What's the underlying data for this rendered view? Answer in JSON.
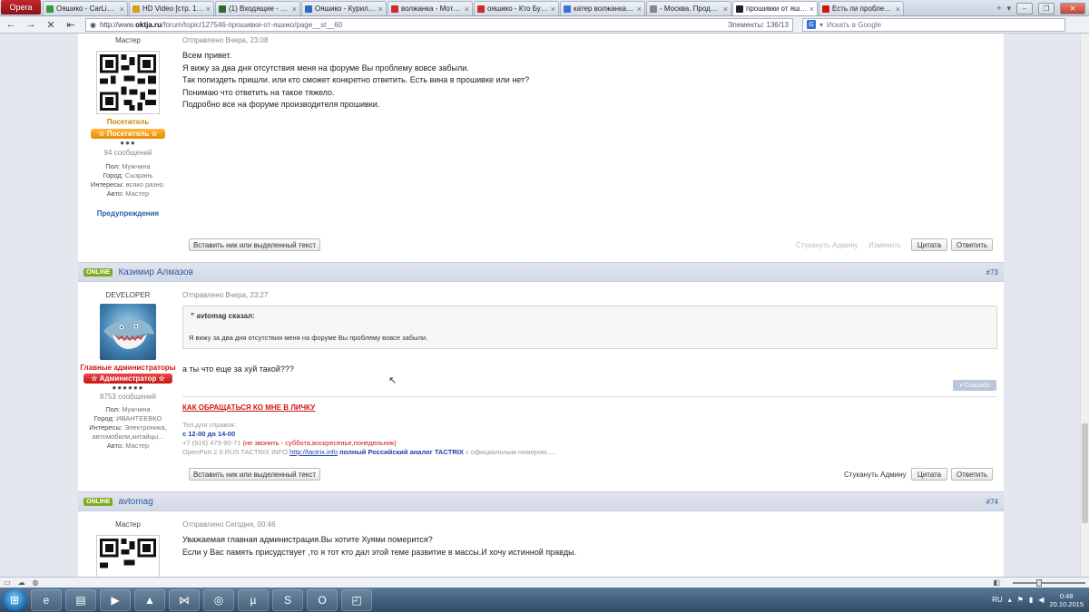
{
  "browser": {
    "opera_label": "Opera",
    "tabs": [
      {
        "title": "Ояшико - CarLine For...",
        "color": "#3a9a3a",
        "active": false
      },
      {
        "title": "HD Video [стр. 1] :: Ки...",
        "color": "#d8a019",
        "active": false
      },
      {
        "title": "(1) Входящие - avtom...",
        "color": "#2d6a2d",
        "active": false
      },
      {
        "title": "Ояшико - Курилка - ...",
        "color": "#2a6ac8",
        "active": false
      },
      {
        "title": "волжанка - Моторны...",
        "color": "#d02a2a",
        "active": false
      },
      {
        "title": "ояшико - Кто Бухает ...",
        "color": "#d02a2a",
        "active": false
      },
      {
        "title": "катер волжанка фор...",
        "color": "#3b74d4",
        "active": false
      },
      {
        "title": "- Москва. Продается ...",
        "color": "#888888",
        "active": false
      },
      {
        "title": "прошивки от яшик...",
        "color": "#222222",
        "active": true
      },
      {
        "title": "Есть ли проблемы с ...",
        "color": "#d01515",
        "active": false
      }
    ],
    "url_prefix": "http://www.",
    "url_host": "oktja.ru",
    "url_rest": "/forum/topic/127546-прошивки-от-яшико/page__st__60",
    "elements_label": "Элементы:",
    "elements_count": "136/13",
    "search_placeholder": "Искать в Google",
    "search_engine": "G"
  },
  "posts": [
    {
      "role": "Мастер",
      "posted": "Отправлено Вчера, 23:08",
      "rank_text": "Посетитель",
      "badge": "Посетитель",
      "dots": "●●●",
      "msg_count": "94 сообщений",
      "info": [
        {
          "k": "Пол:",
          "v": "Мужчина"
        },
        {
          "k": "Город:",
          "v": "Сызрань"
        },
        {
          "k": "Интересы:",
          "v": "всяко разно."
        },
        {
          "k": "Авто:",
          "v": "Мастер"
        }
      ],
      "warnings": "Предупреждения",
      "lines": [
        "Всем привет.",
        "Я вижу за два дня отсутствия меня на форуме Вы проблему вовсе забыли.",
        "Так попиздеть пришли. или кто сможет конкретно ответить. Есть вина в прошивке или нет?",
        "Понимаю что ответить на такое тяжело.",
        "Подробно все на форуме производителя прошивки."
      ],
      "insert_btn": "Вставить ник или выделенный текст",
      "report": "Стукануть Админу",
      "edit": "Изменить",
      "quote_btn": "Цитата",
      "reply_btn": "Ответить"
    },
    {
      "online": "ONLINE",
      "name": "Казимир Алмазов",
      "num": "#73",
      "role": "DEVELOPER",
      "posted": "Отправлено Вчера, 23:27",
      "group": "Главные администраторы",
      "badge": "Администратор",
      "dots": "●●●●●●",
      "msg_count": "8753 сообщений",
      "info": [
        {
          "k": "Пол:",
          "v": "Мужчина"
        },
        {
          "k": "Город:",
          "v": "ИВАНТЕЕВКО"
        },
        {
          "k": "Интересы:",
          "v": "Электроника,"
        },
        {
          "k": "",
          "v": "автомобили,китайцы..."
        },
        {
          "k": "Авто:",
          "v": "Мастер"
        }
      ],
      "quote_author": "avtomag сказал:",
      "quote_text": "Я вижу за два дня отсутствия меня на форуме Вы проблему вовсе забыли.",
      "text": "а ты что еще за хуй такой???",
      "thanks": "Спасибо",
      "sig_title": "КАК ОБРАЩАТЬСЯ КО МНЕ В ЛИЧКУ",
      "sig_phone_label": "Тел.для справок:",
      "sig_hours": "с 12-00 до 14-00",
      "sig_phone": "+7 (916) 479-90-71",
      "sig_note": "(не звонить - суббота,воскресенье,понедельник)",
      "sig_op_a": "OpenPort 2.0 RUS TACTRIX INFO",
      "sig_link": "http://tactrix.info",
      "sig_op_b": "полный Российский аналог TACTRIX",
      "sig_op_c": "с официальным номером.....",
      "insert_btn": "Вставить ник или выделенный текст",
      "report": "Стукануть Админу",
      "quote_btn": "Цитата",
      "reply_btn": "Ответить"
    },
    {
      "online": "ONLINE",
      "name": "avtomag",
      "num": "#74",
      "role": "Мастер",
      "posted": "Отправлено Сегодня, 00:46",
      "lines": [
        "Уважаемая главная администрация.Вы хотите Хуями померится?",
        "Если у Вас память присудствует ,то я тот кто дал этой теме развитие в массы.И хочу истинной правды."
      ]
    }
  ],
  "tray": {
    "lang": "RU",
    "time": "0:48",
    "date": "20.10.2015"
  }
}
